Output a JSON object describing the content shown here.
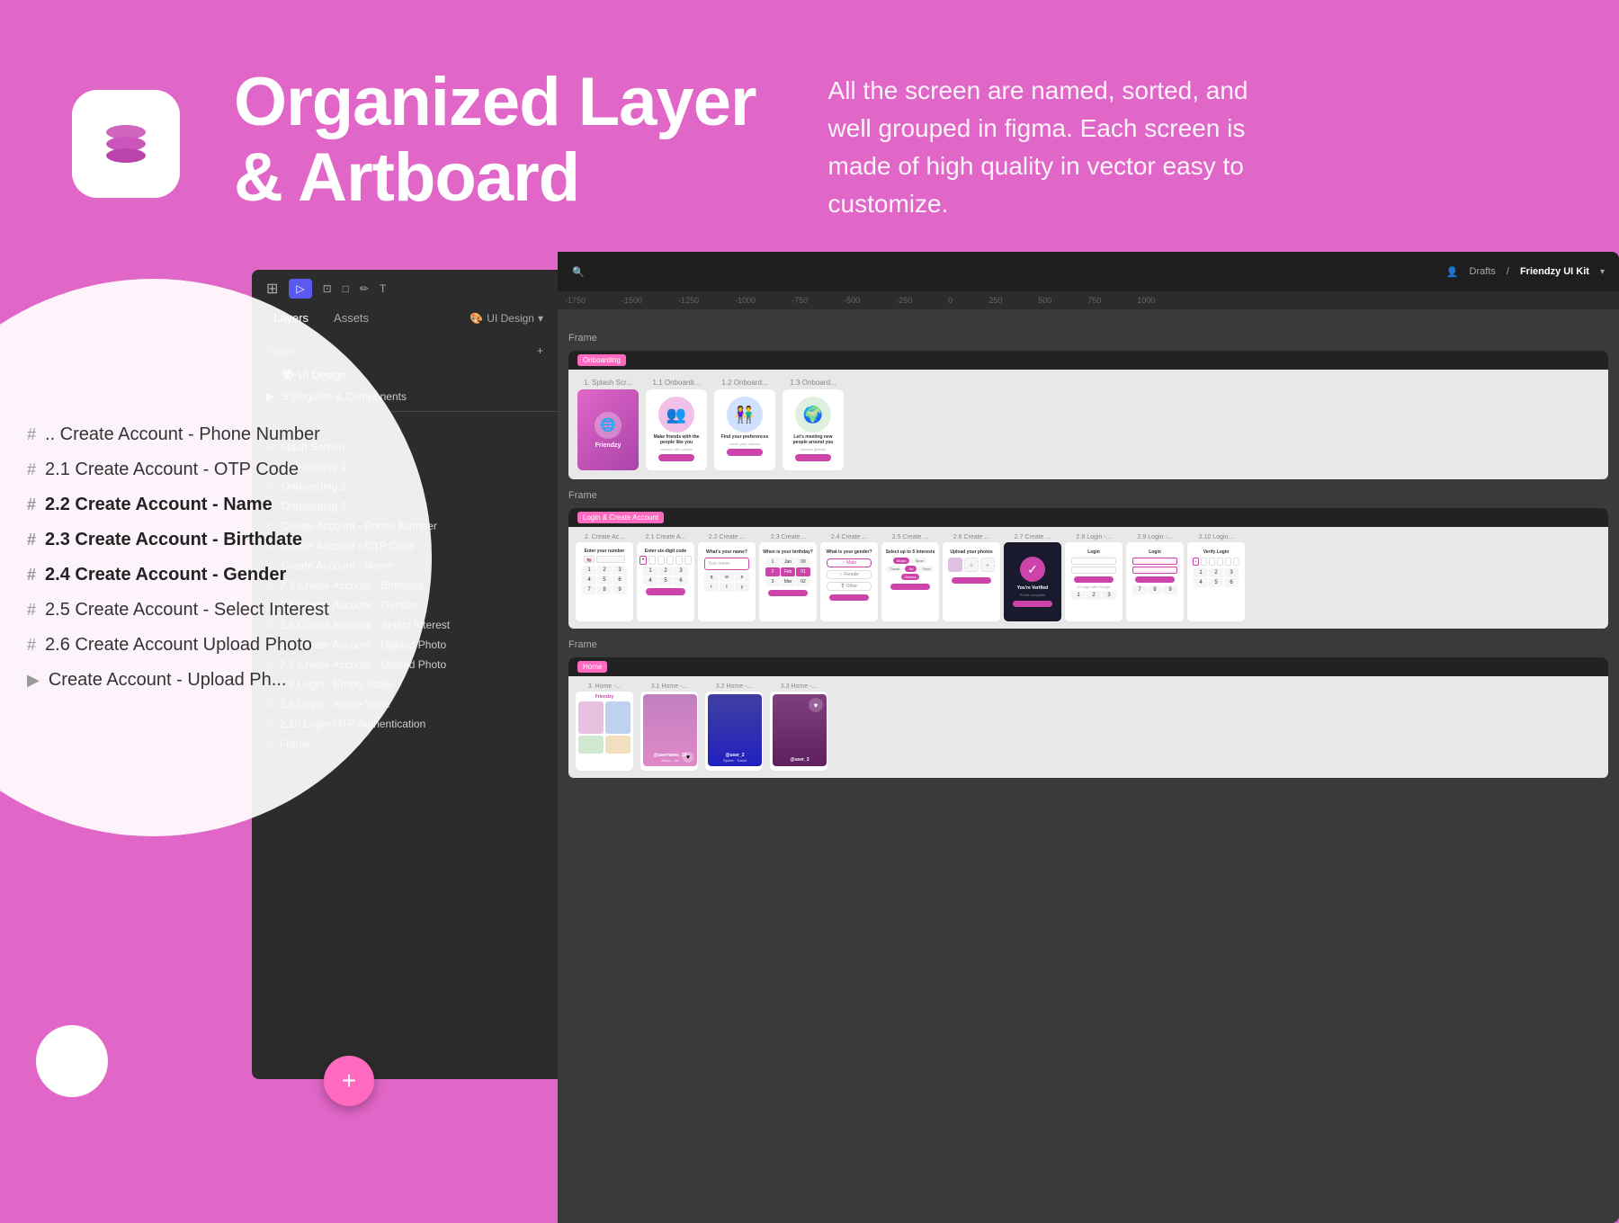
{
  "header": {
    "title_line1": "Organized Layer",
    "title_line2": "& Artboard",
    "description": "All the screen are named, sorted, and well grouped in figma. Each screen is made of high quality in vector easy to customize.",
    "logo_icon_label": "layers-stack"
  },
  "figma": {
    "toolbar": {
      "tabs": [
        "Layers",
        "Assets"
      ],
      "active_tab": "Layers",
      "page_label": "UI Design",
      "drafts_label": "Drafts",
      "project_label": "Friendzy UI Kit"
    },
    "pages": [
      {
        "label": "🎨 UI Design",
        "active": true,
        "has_check": true
      },
      {
        "label": "Styleguide & Components",
        "active": false,
        "has_check": false
      }
    ],
    "layers": [
      {
        "type": "section",
        "label": "me"
      },
      {
        "type": "item",
        "icon": "frame",
        "label": "Flash Screen"
      },
      {
        "type": "item",
        "icon": "frame",
        "label": "Onboarding 1"
      },
      {
        "type": "item",
        "icon": "frame",
        "label": "Onboarding 2"
      },
      {
        "type": "item",
        "icon": "frame",
        "label": "Onboarding 3"
      },
      {
        "type": "item",
        "icon": "frame",
        "label": "Create Account - Phone Number"
      },
      {
        "type": "item",
        "icon": "frame",
        "label": "Create Account - OTP Code"
      },
      {
        "type": "item",
        "icon": "frame",
        "label": "Create Account - Name"
      },
      {
        "type": "item",
        "icon": "hash",
        "label": "2.3 Create Account - Birthdate"
      },
      {
        "type": "item",
        "icon": "hash",
        "label": "2.4 Create Account - Gender"
      },
      {
        "type": "item",
        "icon": "hash",
        "label": "2.5 Create Account - Select Interest"
      },
      {
        "type": "item",
        "icon": "hash",
        "label": "2.6 Create Account - Upload Photo"
      },
      {
        "type": "item",
        "icon": "hash",
        "label": "2.7 Create Account - Upload Photo"
      },
      {
        "type": "item",
        "icon": "hash",
        "label": "2.8 Login - Empty State"
      },
      {
        "type": "item",
        "icon": "hash",
        "label": "2.9 Login - Active State"
      },
      {
        "type": "item",
        "icon": "hash",
        "label": "2.10 Login OTP Authentication"
      },
      {
        "type": "item",
        "icon": "hash",
        "label": "Frame"
      }
    ],
    "canvas_frames": [
      {
        "label": "Onboarding",
        "tabs": [
          "1. Splash Scr...",
          "1.1 Onboardi...",
          "1.2 Onboard...",
          "1.3 Onboard..."
        ]
      },
      {
        "label": "Login & Create Account",
        "tabs": [
          "2. Create Ac...",
          "2.1 Create A...",
          "2.2 Create ...",
          "2.3 Create...",
          "2.4 Create ...",
          "2.5 Create ...",
          "2.6 Create ...",
          "2.7 Create ...",
          "2.8 Login -...",
          "2.9 Login -...",
          "2.10 Login..."
        ]
      },
      {
        "label": "Home",
        "tabs": [
          "3. Home -...",
          "3.1 Home -...",
          "3.2 Home -...",
          "3.3 Home -..."
        ]
      }
    ]
  },
  "circle_overlay": {
    "items": [
      {
        "hash": true,
        "label": ".. Create Account - Phone Number",
        "highlighted": false
      },
      {
        "hash": true,
        "label": "2.1 Create Account - OTP Code",
        "highlighted": false
      },
      {
        "hash": true,
        "label": "2.2 Create Account - Name",
        "highlighted": true
      },
      {
        "hash": true,
        "label": "2.3 Create Account - Birthdate",
        "highlighted": true
      },
      {
        "hash": true,
        "label": "2.4 Create Account - Gender",
        "highlighted": true
      },
      {
        "hash": true,
        "label": "2.5 Create Account - Select Interest",
        "highlighted": false
      },
      {
        "hash": true,
        "label": "2.6 Create Account Upload Photo",
        "highlighted": false
      },
      {
        "hash": false,
        "label": "Create Account - Upload Ph...",
        "highlighted": false
      }
    ]
  },
  "plus_button": {
    "label": "+"
  },
  "colors": {
    "bg_pink": "#e066c7",
    "accent_pink": "#ff69c0",
    "circle_bg": "rgba(255,255,255,0.92)",
    "dark_panel": "#2c2c2c"
  }
}
